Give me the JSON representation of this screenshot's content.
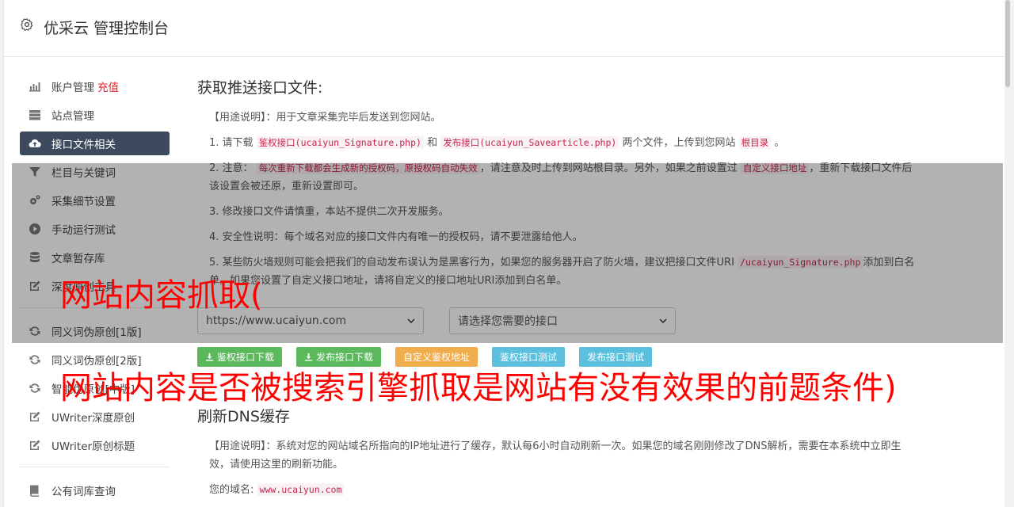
{
  "header": {
    "title": "优采云 管理控制台"
  },
  "sidebar": {
    "items": [
      {
        "label": "账户管理",
        "extra": "充值",
        "icon": "bar-chart-icon"
      },
      {
        "label": "站点管理",
        "icon": "server-icon"
      },
      {
        "label": "接口文件相关",
        "icon": "cloud-upload-icon",
        "active": true
      },
      {
        "label": "栏目与关键词",
        "icon": "filter-icon"
      },
      {
        "label": "采集细节设置",
        "icon": "gears-icon"
      },
      {
        "label": "手动运行测试",
        "icon": "play-circle-icon"
      },
      {
        "label": "文章暂存库",
        "icon": "database-icon"
      },
      {
        "label": "深度原创工具",
        "icon": "edit-icon"
      },
      {
        "label": "同义词伪原创[1版]",
        "icon": "refresh-icon"
      },
      {
        "label": "同义词伪原创[2版]",
        "icon": "refresh-icon"
      },
      {
        "label": "智能伪原创[中版]",
        "icon": "refresh-icon"
      },
      {
        "label": "UWriter深度原创",
        "icon": "edit-icon"
      },
      {
        "label": "UWriter原创标题",
        "icon": "edit-icon"
      },
      {
        "label": "公有词库查询",
        "icon": "book-icon"
      }
    ]
  },
  "main": {
    "section1_title": "获取推送接口文件:",
    "usage_label": "【用途说明】",
    "usage_text": "：用于文章采集完毕后发送到您网站。",
    "step1": {
      "a": "1. 请下载",
      "code1": "鉴权接口(ucaiyun_Signature.php)",
      "b": "和",
      "code2": "发布接口(ucaiyun_Savearticle.php)",
      "c": "两个文件，上传到您网站",
      "code3": "根目录",
      "d": "。"
    },
    "step2": {
      "a": "2. 注意：",
      "code1": "每次重新下载都会生成新的授权码，原授权码自动失效",
      "b": "，请注意及时上传到网站根目录。另外，如果之前设置过",
      "code2": "自定义接口地址",
      "c": "，重新下载接口文件后该设置会被还原，重新设置即可。"
    },
    "step3": "3. 修改接口文件请慎重，本站不提供二次开发服务。",
    "step4": "4. 安全性说明：每个域名对应的接口文件内有唯一的授权码，请不要泄露给他人。",
    "step5": {
      "a": "5. 某些防火墙规则可能会把我们的自动发布误认为是黑客行为，如果您的服务器开启了防火墙，建议把接口文件URI",
      "code1": "/ucaiyun_Signature.php",
      "b": "添加到白名单。如果您设置了自定义接口地址，请将自定义的接口地址URI添加到白名单。"
    },
    "select_site": "https://www.ucaiyun.com",
    "select_api": "请选择您需要的接口",
    "buttons": {
      "sig_download": "鉴权接口下载",
      "pub_download": "发布接口下载",
      "custom_sig": "自定义鉴权地址",
      "sig_test": "鉴权接口测试",
      "pub_test": "发布接口测试"
    },
    "section2_title": "刷新DNS缓存",
    "dns_usage_label": "【用途说明】",
    "dns_usage_text": "：系统对您的网站域名所指向的IP地址进行了缓存，默认每6小时自动刷新一次。如果您的域名刚刚修改了DNS解析，需要在本系统中立即生效，请使用这里的刷新功能。",
    "domain_label": "您的域名:",
    "domain_value": "www.ucaiyun.com"
  },
  "overlay_text": {
    "line1": "网站内容抓取(",
    "line2": "网站内容是否被搜索引擎抓取是网站有没有效果的前题条件)"
  }
}
